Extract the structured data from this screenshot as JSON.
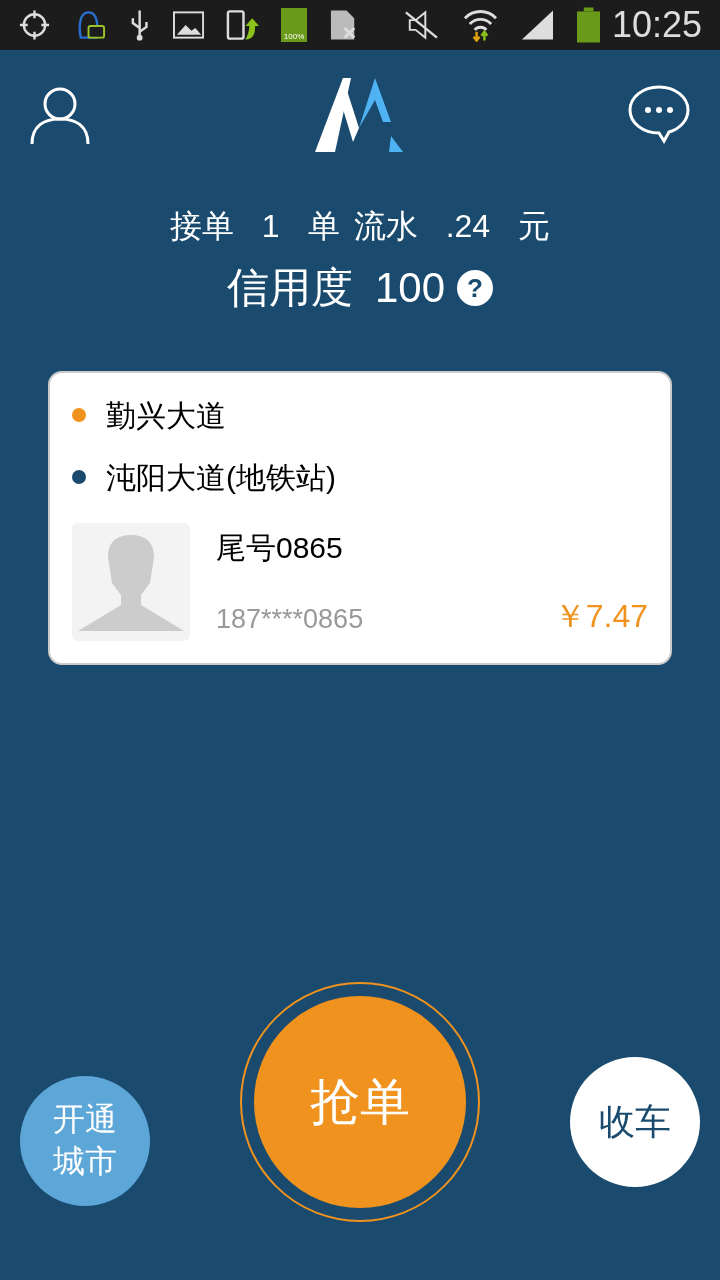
{
  "status_bar": {
    "battery_label": "100%",
    "time": "10:25"
  },
  "stats": [
    "接单",
    "1",
    "单",
    "流水",
    ".24",
    "元"
  ],
  "credit": {
    "label": "信用度",
    "value": "100",
    "help": "?"
  },
  "order": {
    "stops": [
      {
        "name": "勤兴大道",
        "color": "#f0921e"
      },
      {
        "name": "沌阳大道(地铁站)",
        "color": "#1a4b6e"
      }
    ],
    "passenger": "尾号0865",
    "phone": "187****0865",
    "price": "￥7.47"
  },
  "buttons": {
    "cities": "开通城市",
    "grab": "抢单",
    "stop": "收车"
  }
}
